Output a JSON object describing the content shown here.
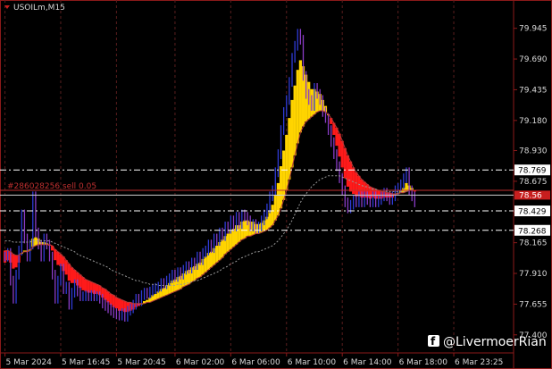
{
  "window": {
    "symbol_label": "USOILm,M15"
  },
  "order_line": {
    "label": "#286028256 sell 0.05"
  },
  "watermark": {
    "text": "@LivermoerRian"
  },
  "colors": {
    "background": "#000000",
    "border": "#8b1a1a",
    "bull_candle": "#2f3bd6",
    "bear_candle": "#8a3cc7",
    "cloud_up": "#ffd400",
    "cloud_down": "#ff1a1a",
    "ma_slow": "#b33b3b",
    "ma_dotted": "#9a9a9a",
    "level_line": "#ffffff",
    "order_line": "#c03030",
    "price_tag_red": "#c81e1e"
  },
  "chart_data": {
    "type": "line",
    "title": "USOILm,M15",
    "xlabel": "",
    "ylabel": "",
    "ylim": [
      77.25,
      80.18
    ],
    "xlim": [
      0,
      182
    ],
    "grid": true,
    "grid_style": "dashed-vertical",
    "x_ticks": [
      {
        "i": 0,
        "label": "5 Mar 2024"
      },
      {
        "i": 20,
        "label": "5 Mar 16:45"
      },
      {
        "i": 40,
        "label": "5 Mar 20:45"
      },
      {
        "i": 61,
        "label": "6 Mar 02:00"
      },
      {
        "i": 81,
        "label": "6 Mar 06:00"
      },
      {
        "i": 101,
        "label": "6 Mar 10:00"
      },
      {
        "i": 121,
        "label": "6 Mar 14:00"
      },
      {
        "i": 141,
        "label": "6 Mar 18:00"
      },
      {
        "i": 161,
        "label": "6 Mar 23:25"
      }
    ],
    "y_ticks": [
      77.4,
      77.655,
      77.91,
      78.165,
      78.42,
      78.675,
      78.93,
      79.18,
      79.435,
      79.69,
      79.945
    ],
    "y_tick_labels": [
      "77.400",
      "77.655",
      "77.910",
      "78.165",
      "78.420",
      "78.675",
      "78.930",
      "79.180",
      "79.435",
      "79.690",
      "79.945"
    ],
    "horizontal_levels": [
      {
        "value": 78.769,
        "label": "78.769",
        "style": "dash-dot",
        "color": "#ffffff"
      },
      {
        "value": 78.429,
        "label": "78.429",
        "style": "dash-dot",
        "color": "#ffffff"
      },
      {
        "value": 78.268,
        "label": "78.268",
        "style": "dash-dot",
        "color": "#ffffff"
      }
    ],
    "order_price": 78.6,
    "bid_price": 78.56,
    "bid_label": "78.56",
    "series": [
      {
        "kind": "close",
        "values": [
          78.05,
          78.08,
          77.85,
          77.7,
          77.9,
          78.1,
          78.4,
          78.2,
          78.05,
          78.15,
          78.55,
          78.25,
          78.15,
          78.05,
          78.2,
          78.15,
          78.05,
          77.9,
          77.7,
          77.85,
          77.95,
          77.78,
          77.8,
          77.65,
          77.75,
          77.82,
          77.76,
          77.72,
          77.72,
          77.73,
          77.72,
          77.73,
          77.72,
          77.72,
          77.7,
          77.66,
          77.64,
          77.62,
          77.6,
          77.58,
          77.57,
          77.56,
          77.58,
          77.55,
          77.6,
          77.62,
          77.65,
          77.7,
          77.68,
          77.73,
          77.75,
          77.74,
          77.76,
          77.78,
          77.79,
          77.8,
          77.83,
          77.82,
          77.85,
          77.87,
          77.9,
          77.88,
          77.92,
          77.9,
          77.94,
          77.97,
          77.95,
          78.0,
          77.98,
          78.05,
          78.02,
          78.08,
          78.1,
          78.15,
          78.12,
          78.2,
          78.18,
          78.25,
          78.22,
          78.3,
          78.28,
          78.35,
          78.3,
          78.38,
          78.32,
          78.4,
          78.38,
          78.35,
          78.3,
          78.32,
          78.28,
          78.3,
          78.35,
          78.4,
          78.45,
          78.55,
          78.6,
          78.75,
          78.9,
          79.1,
          79.25,
          79.35,
          79.5,
          79.7,
          79.8,
          79.9,
          79.85,
          79.55,
          79.4,
          79.35,
          79.3,
          79.45,
          79.4,
          79.35,
          79.25,
          79.2,
          79.1,
          79.0,
          78.9,
          78.8,
          78.7,
          78.6,
          78.5,
          78.45,
          78.48,
          78.52,
          78.5,
          78.55,
          78.5,
          78.55,
          78.52,
          78.5,
          78.55,
          78.5,
          78.52,
          78.55,
          78.58,
          78.55,
          78.52,
          78.55,
          78.6,
          78.62,
          78.65,
          78.7,
          78.75,
          78.6,
          78.55,
          78.5
        ],
        "color": "#2f3bd6"
      },
      {
        "kind": "fast_ma",
        "values": [
          78.0,
          78.02,
          78.0,
          77.95,
          77.96,
          78.0,
          78.08,
          78.1,
          78.1,
          78.11,
          78.2,
          78.21,
          78.2,
          78.17,
          78.17,
          78.16,
          78.14,
          78.1,
          78.02,
          77.98,
          77.97,
          77.93,
          77.9,
          77.85,
          77.83,
          77.83,
          77.81,
          77.79,
          77.77,
          77.76,
          77.75,
          77.75,
          77.74,
          77.74,
          77.73,
          77.71,
          77.69,
          77.67,
          77.65,
          77.63,
          77.62,
          77.6,
          77.6,
          77.59,
          77.59,
          77.6,
          77.61,
          77.63,
          77.64,
          77.66,
          77.68,
          77.69,
          77.71,
          77.73,
          77.74,
          77.76,
          77.78,
          77.79,
          77.81,
          77.83,
          77.85,
          77.86,
          77.88,
          77.89,
          77.91,
          77.93,
          77.94,
          77.96,
          77.97,
          77.99,
          78.0,
          78.03,
          78.05,
          78.08,
          78.09,
          78.12,
          78.14,
          78.17,
          78.19,
          78.22,
          78.24,
          78.27,
          78.28,
          78.31,
          78.31,
          78.34,
          78.35,
          78.35,
          78.34,
          78.34,
          78.32,
          78.32,
          78.33,
          78.35,
          78.38,
          78.43,
          78.48,
          78.56,
          78.66,
          78.8,
          78.93,
          79.06,
          79.2,
          79.35,
          79.47,
          79.6,
          79.68,
          79.63,
          79.56,
          79.5,
          79.44,
          79.44,
          79.42,
          79.4,
          79.35,
          79.3,
          79.23,
          79.15,
          79.06,
          78.97,
          78.88,
          78.79,
          78.7,
          78.63,
          78.59,
          78.57,
          78.55,
          78.55,
          78.54,
          78.54,
          78.54,
          78.53,
          78.54,
          78.53,
          78.53,
          78.53,
          78.54,
          78.54,
          78.54,
          78.54,
          78.56,
          78.58,
          78.6,
          78.62,
          78.66,
          78.64,
          78.62,
          78.59
        ],
        "color": "#ffd400"
      },
      {
        "kind": "slow_ma",
        "values": [
          78.1,
          78.1,
          78.09,
          78.07,
          78.06,
          78.06,
          78.08,
          78.09,
          78.09,
          78.1,
          78.13,
          78.14,
          78.15,
          78.15,
          78.15,
          78.15,
          78.15,
          78.14,
          78.11,
          78.09,
          78.07,
          78.05,
          78.02,
          77.99,
          77.96,
          77.94,
          77.92,
          77.9,
          77.88,
          77.86,
          77.85,
          77.84,
          77.83,
          77.82,
          77.81,
          77.79,
          77.78,
          77.76,
          77.74,
          77.73,
          77.71,
          77.7,
          77.69,
          77.68,
          77.67,
          77.67,
          77.66,
          77.66,
          77.66,
          77.66,
          77.66,
          77.67,
          77.67,
          77.68,
          77.69,
          77.7,
          77.71,
          77.72,
          77.73,
          77.74,
          77.75,
          77.76,
          77.77,
          77.78,
          77.8,
          77.81,
          77.82,
          77.84,
          77.85,
          77.87,
          77.88,
          77.9,
          77.92,
          77.94,
          77.96,
          77.98,
          78.0,
          78.02,
          78.04,
          78.07,
          78.09,
          78.11,
          78.13,
          78.15,
          78.17,
          78.19,
          78.2,
          78.22,
          78.22,
          78.23,
          78.24,
          78.24,
          78.25,
          78.26,
          78.27,
          78.29,
          78.31,
          78.35,
          78.39,
          78.45,
          78.52,
          78.6,
          78.69,
          78.79,
          78.89,
          78.99,
          79.08,
          79.13,
          79.17,
          79.19,
          79.21,
          79.23,
          79.25,
          79.26,
          79.26,
          79.25,
          79.23,
          79.2,
          79.16,
          79.12,
          79.07,
          79.01,
          78.95,
          78.89,
          78.84,
          78.79,
          78.75,
          78.72,
          78.69,
          78.67,
          78.65,
          78.63,
          78.62,
          78.61,
          78.6,
          78.59,
          78.59,
          78.58,
          78.58,
          78.57,
          78.57,
          78.57,
          78.58,
          78.58,
          78.59,
          78.6,
          78.6,
          78.6
        ],
        "color": "#b33b3b"
      },
      {
        "kind": "long_ma",
        "values": [
          78.18,
          78.18,
          78.18,
          78.17,
          78.17,
          78.17,
          78.17,
          78.17,
          78.17,
          78.17,
          78.18,
          78.18,
          78.18,
          78.18,
          78.18,
          78.18,
          78.18,
          78.17,
          78.16,
          78.15,
          78.14,
          78.13,
          78.12,
          78.11,
          78.1,
          78.09,
          78.07,
          78.06,
          78.05,
          78.04,
          78.03,
          78.02,
          78.01,
          78.0,
          77.99,
          77.98,
          77.97,
          77.96,
          77.94,
          77.93,
          77.92,
          77.91,
          77.9,
          77.89,
          77.88,
          77.87,
          77.86,
          77.85,
          77.85,
          77.84,
          77.83,
          77.83,
          77.82,
          77.82,
          77.82,
          77.81,
          77.81,
          77.81,
          77.81,
          77.81,
          77.81,
          77.81,
          77.82,
          77.82,
          77.82,
          77.83,
          77.83,
          77.84,
          77.85,
          77.85,
          77.86,
          77.87,
          77.88,
          77.89,
          77.9,
          77.91,
          77.92,
          77.93,
          77.95,
          77.96,
          77.97,
          77.99,
          78.0,
          78.01,
          78.03,
          78.04,
          78.05,
          78.06,
          78.07,
          78.08,
          78.09,
          78.09,
          78.1,
          78.11,
          78.12,
          78.13,
          78.14,
          78.16,
          78.18,
          78.21,
          78.24,
          78.27,
          78.31,
          78.35,
          78.4,
          78.45,
          78.5,
          78.54,
          78.57,
          78.6,
          78.63,
          78.65,
          78.67,
          78.69,
          78.7,
          78.71,
          78.72,
          78.72,
          78.72,
          78.72,
          78.72,
          78.71,
          78.7,
          78.69,
          78.68,
          78.67,
          78.66,
          78.65,
          78.64,
          78.63,
          78.63,
          78.62,
          78.61,
          78.61,
          78.6,
          78.6,
          78.6,
          78.59,
          78.59,
          78.59,
          78.59,
          78.59,
          78.59,
          78.59,
          78.59,
          78.6,
          78.6,
          78.6
        ],
        "color": "#9a9a9a"
      }
    ]
  }
}
